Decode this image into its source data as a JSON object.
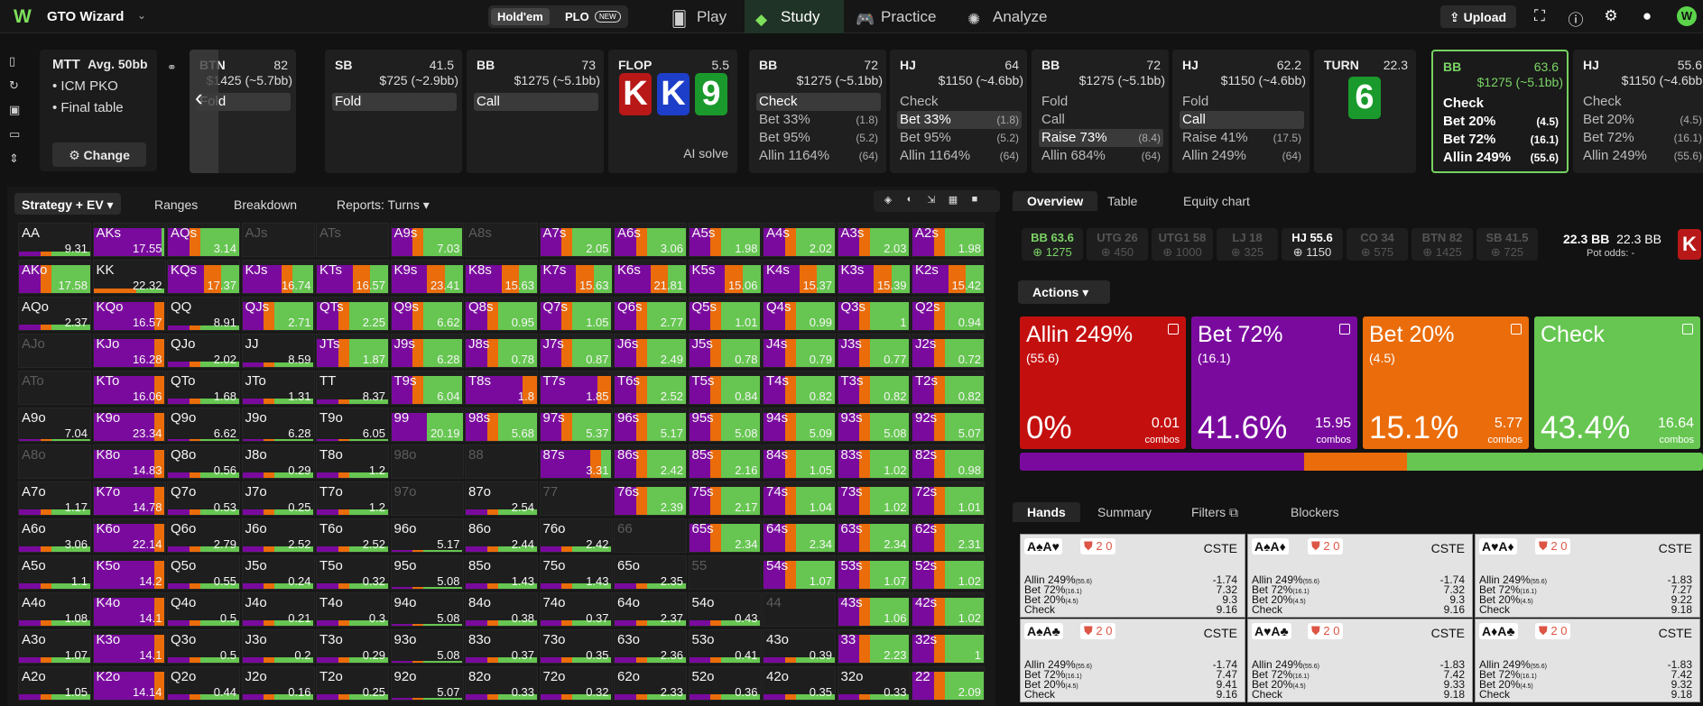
{
  "app": {
    "title": "GTO Wizard",
    "mode_holdem": "Hold'em",
    "mode_plo": "PLO",
    "new_badge": "NEW"
  },
  "nav": {
    "play": "Play",
    "study": "Study",
    "practice": "Practice",
    "analyze": "Analyze",
    "upload": "Upload"
  },
  "mtt": {
    "title": "MTT",
    "avg": "Avg. 50bb",
    "line1": "• ICM PKO",
    "line2": "• Final table",
    "change": "Change"
  },
  "strip": [
    {
      "pos": "BTN",
      "stack": "82",
      "bet": "$1425 (~5.7bb)",
      "acts": [
        {
          "l": "Fold",
          "v": "",
          "sel": true
        }
      ]
    },
    {
      "pos": "SB",
      "stack": "41.5",
      "bet": "$725 (~2.9bb)",
      "acts": [
        {
          "l": "Fold",
          "v": "",
          "sel": true
        }
      ]
    },
    {
      "pos": "BB",
      "stack": "73",
      "bet": "$1275 (~5.1bb)",
      "acts": [
        {
          "l": "Call",
          "v": "",
          "sel": true
        }
      ]
    },
    {
      "pos": "FLOP",
      "stack": "5.5",
      "bet": "",
      "acts": [],
      "cards": [
        "K",
        "K",
        "9"
      ],
      "ai": "AI solve"
    },
    {
      "pos": "BB",
      "stack": "72",
      "bet": "$1275 (~5.1bb)",
      "acts": [
        {
          "l": "Check",
          "v": "",
          "sel": true
        },
        {
          "l": "Bet 33%",
          "v": "(1.8)"
        },
        {
          "l": "Bet 95%",
          "v": "(5.2)"
        },
        {
          "l": "Allin 1164%",
          "v": "(64)"
        }
      ]
    },
    {
      "pos": "HJ",
      "stack": "64",
      "bet": "$1150 (~4.6bb)",
      "acts": [
        {
          "l": "Check",
          "v": ""
        },
        {
          "l": "Bet 33%",
          "v": "(1.8)",
          "sel": true
        },
        {
          "l": "Bet 95%",
          "v": "(5.2)"
        },
        {
          "l": "Allin 1164%",
          "v": "(64)"
        }
      ]
    },
    {
      "pos": "BB",
      "stack": "72",
      "bet": "$1275 (~5.1bb)",
      "acts": [
        {
          "l": "Fold",
          "v": ""
        },
        {
          "l": "Call",
          "v": ""
        },
        {
          "l": "Raise 73%",
          "v": "(8.4)",
          "sel": true
        },
        {
          "l": "Allin 684%",
          "v": "(64)"
        }
      ]
    },
    {
      "pos": "HJ",
      "stack": "62.2",
      "bet": "$1150 (~4.6bb)",
      "acts": [
        {
          "l": "Fold",
          "v": ""
        },
        {
          "l": "Call",
          "v": "",
          "sel": true
        },
        {
          "l": "Raise 41%",
          "v": "(17.5)"
        },
        {
          "l": "Allin 249%",
          "v": "(64)"
        }
      ]
    },
    {
      "pos": "TURN",
      "stack": "22.3",
      "bet": "",
      "acts": [],
      "cards": [
        "6"
      ]
    },
    {
      "pos": "BB",
      "stack": "63.6",
      "bet": "$1275 (~5.1bb)",
      "acts": [
        {
          "l": "Check",
          "v": ""
        },
        {
          "l": "Bet 20%",
          "v": "(4.5)"
        },
        {
          "l": "Bet 72%",
          "v": "(16.1)"
        },
        {
          "l": "Allin 249%",
          "v": "(55.6)"
        }
      ],
      "current": true
    },
    {
      "pos": "HJ",
      "stack": "55.6",
      "bet": "$1150 (~4.6bb)",
      "acts": [
        {
          "l": "Check",
          "v": ""
        },
        {
          "l": "Bet 20%",
          "v": "(4.5)"
        },
        {
          "l": "Bet 72%",
          "v": "(16.1)"
        },
        {
          "l": "Allin 249%",
          "v": "(55.6)"
        }
      ]
    }
  ],
  "left_tabs": {
    "strategy": "Strategy + EV",
    "ranges": "Ranges",
    "breakdown": "Breakdown",
    "reports": "Reports: Turns"
  },
  "grid": [
    [
      "AA",
      "9.31",
      "AKs",
      "17.55",
      "AQs",
      "3.14",
      "AJs",
      "",
      "ATs",
      "",
      "A9s",
      "7.03",
      "A8s",
      "",
      "A7s",
      "2.05",
      "A6s",
      "3.06",
      "A5s",
      "1.98",
      "A4s",
      "2.02",
      "A3s",
      "2.03",
      "A2s",
      "1.98"
    ],
    [
      "AKo",
      "17.58",
      "KK",
      "22.32",
      "KQs",
      "17.37",
      "KJs",
      "16.74",
      "KTs",
      "16.57",
      "K9s",
      "23.41",
      "K8s",
      "15.63",
      "K7s",
      "15.63",
      "K6s",
      "21.81",
      "K5s",
      "15.06",
      "K4s",
      "15.37",
      "K3s",
      "15.39",
      "K2s",
      "15.42"
    ],
    [
      "AQo",
      "2.37",
      "KQo",
      "16.57",
      "QQ",
      "8.91",
      "QJs",
      "2.71",
      "QTs",
      "2.25",
      "Q9s",
      "6.62",
      "Q8s",
      "0.95",
      "Q7s",
      "1.05",
      "Q6s",
      "2.77",
      "Q5s",
      "1.01",
      "Q4s",
      "0.99",
      "Q3s",
      "1",
      "Q2s",
      "0.94"
    ],
    [
      "AJo",
      "",
      "KJo",
      "16.28",
      "QJo",
      "2.02",
      "JJ",
      "8.59",
      "JTs",
      "1.87",
      "J9s",
      "6.28",
      "J8s",
      "0.78",
      "J7s",
      "0.87",
      "J6s",
      "2.49",
      "J5s",
      "0.78",
      "J4s",
      "0.79",
      "J3s",
      "0.77",
      "J2s",
      "0.72"
    ],
    [
      "ATo",
      "",
      "KTo",
      "16.06",
      "QTo",
      "1.68",
      "JTo",
      "1.31",
      "TT",
      "8.37",
      "T9s",
      "6.04",
      "T8s",
      "1.8",
      "T7s",
      "1.85",
      "T6s",
      "2.52",
      "T5s",
      "0.84",
      "T4s",
      "0.82",
      "T3s",
      "0.82",
      "T2s",
      "0.82"
    ],
    [
      "A9o",
      "7.04",
      "K9o",
      "23.34",
      "Q9o",
      "6.62",
      "J9o",
      "6.28",
      "T9o",
      "6.05",
      "99",
      "20.19",
      "98s",
      "5.68",
      "97s",
      "5.37",
      "96s",
      "5.17",
      "95s",
      "5.08",
      "94s",
      "5.09",
      "93s",
      "5.08",
      "92s",
      "5.07"
    ],
    [
      "A8o",
      "",
      "K8o",
      "14.83",
      "Q8o",
      "0.56",
      "J8o",
      "0.29",
      "T8o",
      "1.2",
      "98o",
      "",
      "88",
      "",
      "87s",
      "3.31",
      "86s",
      "2.42",
      "85s",
      "2.16",
      "84s",
      "1.05",
      "83s",
      "1.02",
      "82s",
      "0.98"
    ],
    [
      "A7o",
      "1.17",
      "K7o",
      "14.78",
      "Q7o",
      "0.53",
      "J7o",
      "0.25",
      "T7o",
      "1.2",
      "97o",
      "",
      "87o",
      "2.54",
      "77",
      "",
      "76s",
      "2.39",
      "75s",
      "2.17",
      "74s",
      "1.04",
      "73s",
      "1.02",
      "72s",
      "1.01"
    ],
    [
      "A6o",
      "3.06",
      "K6o",
      "22.14",
      "Q6o",
      "2.79",
      "J6o",
      "2.52",
      "T6o",
      "2.52",
      "96o",
      "5.17",
      "86o",
      "2.44",
      "76o",
      "2.42",
      "66",
      "",
      "65s",
      "2.34",
      "64s",
      "2.34",
      "63s",
      "2.34",
      "62s",
      "2.31"
    ],
    [
      "A5o",
      "1.1",
      "K5o",
      "14.2",
      "Q5o",
      "0.55",
      "J5o",
      "0.24",
      "T5o",
      "0.32",
      "95o",
      "5.08",
      "85o",
      "1.43",
      "75o",
      "1.43",
      "65o",
      "2.35",
      "55",
      "",
      "54s",
      "1.07",
      "53s",
      "1.07",
      "52s",
      "1.02"
    ],
    [
      "A4o",
      "1.08",
      "K4o",
      "14.1",
      "Q4o",
      "0.5",
      "J4o",
      "0.21",
      "T4o",
      "0.3",
      "94o",
      "5.08",
      "84o",
      "0.38",
      "74o",
      "0.37",
      "64o",
      "2.37",
      "54o",
      "0.43",
      "44",
      "",
      "43s",
      "1.06",
      "42s",
      "1.02"
    ],
    [
      "A3o",
      "1.07",
      "K3o",
      "14.1",
      "Q3o",
      "0.5",
      "J3o",
      "0.2",
      "T3o",
      "0.29",
      "93o",
      "5.08",
      "83o",
      "0.37",
      "73o",
      "0.35",
      "63o",
      "2.36",
      "53o",
      "0.41",
      "43o",
      "0.39",
      "33",
      "2.23",
      "32s",
      "1"
    ],
    [
      "A2o",
      "1.05",
      "K2o",
      "14.14",
      "Q2o",
      "0.44",
      "J2o",
      "0.16",
      "T2o",
      "0.25",
      "92o",
      "5.07",
      "82o",
      "0.33",
      "72o",
      "0.32",
      "62o",
      "2.33",
      "52o",
      "0.36",
      "42o",
      "0.35",
      "32o",
      "0.33",
      "22",
      "2.09"
    ]
  ],
  "right_tabs": {
    "overview": "Overview",
    "table": "Table",
    "equity": "Equity chart"
  },
  "players": [
    {
      "a": "BB 63.6",
      "b": "1275",
      "hl": true
    },
    {
      "a": "UTG 26",
      "b": "450"
    },
    {
      "a": "UTG1 58",
      "b": "1000"
    },
    {
      "a": "LJ 18",
      "b": "325"
    },
    {
      "a": "HJ 55.6",
      "b": "1150",
      "w": true
    },
    {
      "a": "CO 34",
      "b": "575"
    },
    {
      "a": "BTN 82",
      "b": "1425"
    },
    {
      "a": "SB 41.5",
      "b": "725"
    }
  ],
  "pot": {
    "l1": "22.3 BB",
    "l2": "22.3 BB",
    "odds": "Pot odds:  -"
  },
  "actions_label": "Actions",
  "action_boxes": [
    {
      "n": "Allin 249%",
      "s": "(55.6)",
      "p": "0%",
      "c": "0.01",
      "cl": "combos",
      "color": "#c40f0f"
    },
    {
      "n": "Bet 72%",
      "s": "(16.1)",
      "p": "41.6%",
      "c": "15.95",
      "cl": "combos",
      "color": "#7a0a9e"
    },
    {
      "n": "Bet 20%",
      "s": "(4.5)",
      "p": "15.1%",
      "c": "5.77",
      "cl": "combos",
      "color": "#ea6c0a"
    },
    {
      "n": "Check",
      "s": "",
      "p": "43.4%",
      "c": "16.64",
      "cl": "combos",
      "color": "#66c651"
    }
  ],
  "dist": [
    {
      "p": 0.0,
      "c": "#c40f0f"
    },
    {
      "p": 41.6,
      "c": "#7a0a9e"
    },
    {
      "p": 15.1,
      "c": "#ea6c0a"
    },
    {
      "p": 43.4,
      "c": "#66c651"
    }
  ],
  "hand_tabs": {
    "hands": "Hands",
    "summary": "Summary",
    "filters": "Filters",
    "blockers": "Blockers"
  },
  "hands": [
    {
      "cards": "A♠A♥",
      "blk": "2  0",
      "cste": "CSTE",
      "rows": [
        [
          "Allin 249%",
          "(55.6)",
          "-1.74"
        ],
        [
          "Bet 72%",
          "(16.1)",
          "7.32"
        ],
        [
          "Bet 20%",
          "(4.5)",
          "9.3"
        ],
        [
          "Check",
          "",
          "9.16"
        ]
      ]
    },
    {
      "cards": "A♠A♦",
      "blk": "2  0",
      "cste": "CSTE",
      "rows": [
        [
          "Allin 249%",
          "(55.6)",
          "-1.74"
        ],
        [
          "Bet 72%",
          "(16.1)",
          "7.32"
        ],
        [
          "Bet 20%",
          "(4.5)",
          "9.3"
        ],
        [
          "Check",
          "",
          "9.16"
        ]
      ]
    },
    {
      "cards": "A♥A♦",
      "blk": "2  0",
      "cste": "CSTE",
      "rows": [
        [
          "Allin 249%",
          "(55.6)",
          "-1.83"
        ],
        [
          "Bet 72%",
          "(16.1)",
          "7.27"
        ],
        [
          "Bet 20%",
          "(4.5)",
          "9.22"
        ],
        [
          "Check",
          "",
          "9.18"
        ]
      ]
    },
    {
      "cards": "A♠A♣",
      "blk": "2  0",
      "cste": "CSTE",
      "rows": [
        [
          "Allin 249%",
          "(55.6)",
          "-1.74"
        ],
        [
          "Bet 72%",
          "(16.1)",
          "7.47"
        ],
        [
          "Bet 20%",
          "(4.5)",
          "9.41"
        ],
        [
          "Check",
          "",
          "9.16"
        ]
      ]
    },
    {
      "cards": "A♥A♣",
      "blk": "2  0",
      "cste": "CSTE",
      "rows": [
        [
          "Allin 249%",
          "(55.6)",
          "-1.83"
        ],
        [
          "Bet 72%",
          "(16.1)",
          "7.42"
        ],
        [
          "Bet 20%",
          "(4.5)",
          "9.33"
        ],
        [
          "Check",
          "",
          "9.18"
        ]
      ]
    },
    {
      "cards": "A♦A♣",
      "blk": "2  0",
      "cste": "CSTE",
      "rows": [
        [
          "Allin 249%",
          "(55.6)",
          "-1.83"
        ],
        [
          "Bet 72%",
          "(16.1)",
          "7.42"
        ],
        [
          "Bet 20%",
          "(4.5)",
          "9.32"
        ],
        [
          "Check",
          "",
          "9.18"
        ]
      ]
    }
  ]
}
